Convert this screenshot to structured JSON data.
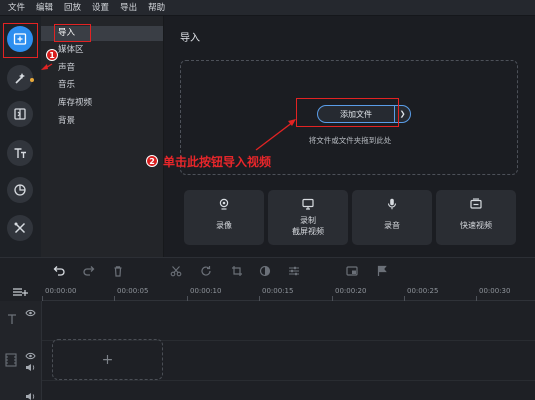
{
  "menu": [
    "文件",
    "编辑",
    "回放",
    "设置",
    "导出",
    "帮助"
  ],
  "left_tools": [
    {
      "icon": "import-icon",
      "active": true
    },
    {
      "icon": "magic-wand-icon",
      "active": false
    },
    {
      "icon": "transition-icon",
      "active": false
    },
    {
      "icon": "titles-icon",
      "active": false
    },
    {
      "icon": "stickers-icon",
      "active": false
    },
    {
      "icon": "tools-icon",
      "active": false
    }
  ],
  "sidebar": {
    "items": [
      "导入",
      "媒体区",
      "声音",
      "音乐",
      "库存视频",
      "背景"
    ]
  },
  "main": {
    "title": "导入",
    "add_file_label": "添加文件",
    "dropdown_glyph": "❯",
    "drop_hint": "将文件或文件夹拖到此处",
    "cards": [
      {
        "label": "录像",
        "icon": "webcam-icon"
      },
      {
        "label": "录制\n截屏视频",
        "icon": "screen-record-icon"
      },
      {
        "label": "录音",
        "icon": "microphone-icon"
      },
      {
        "label": "快速视频",
        "icon": "quick-video-icon"
      }
    ]
  },
  "annotations": {
    "badge1": "1",
    "badge2": "2",
    "text2": "单击此按钮导入视频",
    "accent": "#e22323"
  },
  "timeline": {
    "ticks": [
      "00:00:00",
      "00:00:05",
      "00:00:10",
      "00:00:15",
      "00:00:20",
      "00:00:25",
      "00:00:30"
    ],
    "add_clip_glyph": "+"
  },
  "colors": {
    "accent": "#2d8ff0",
    "background": "#1b1d22"
  }
}
